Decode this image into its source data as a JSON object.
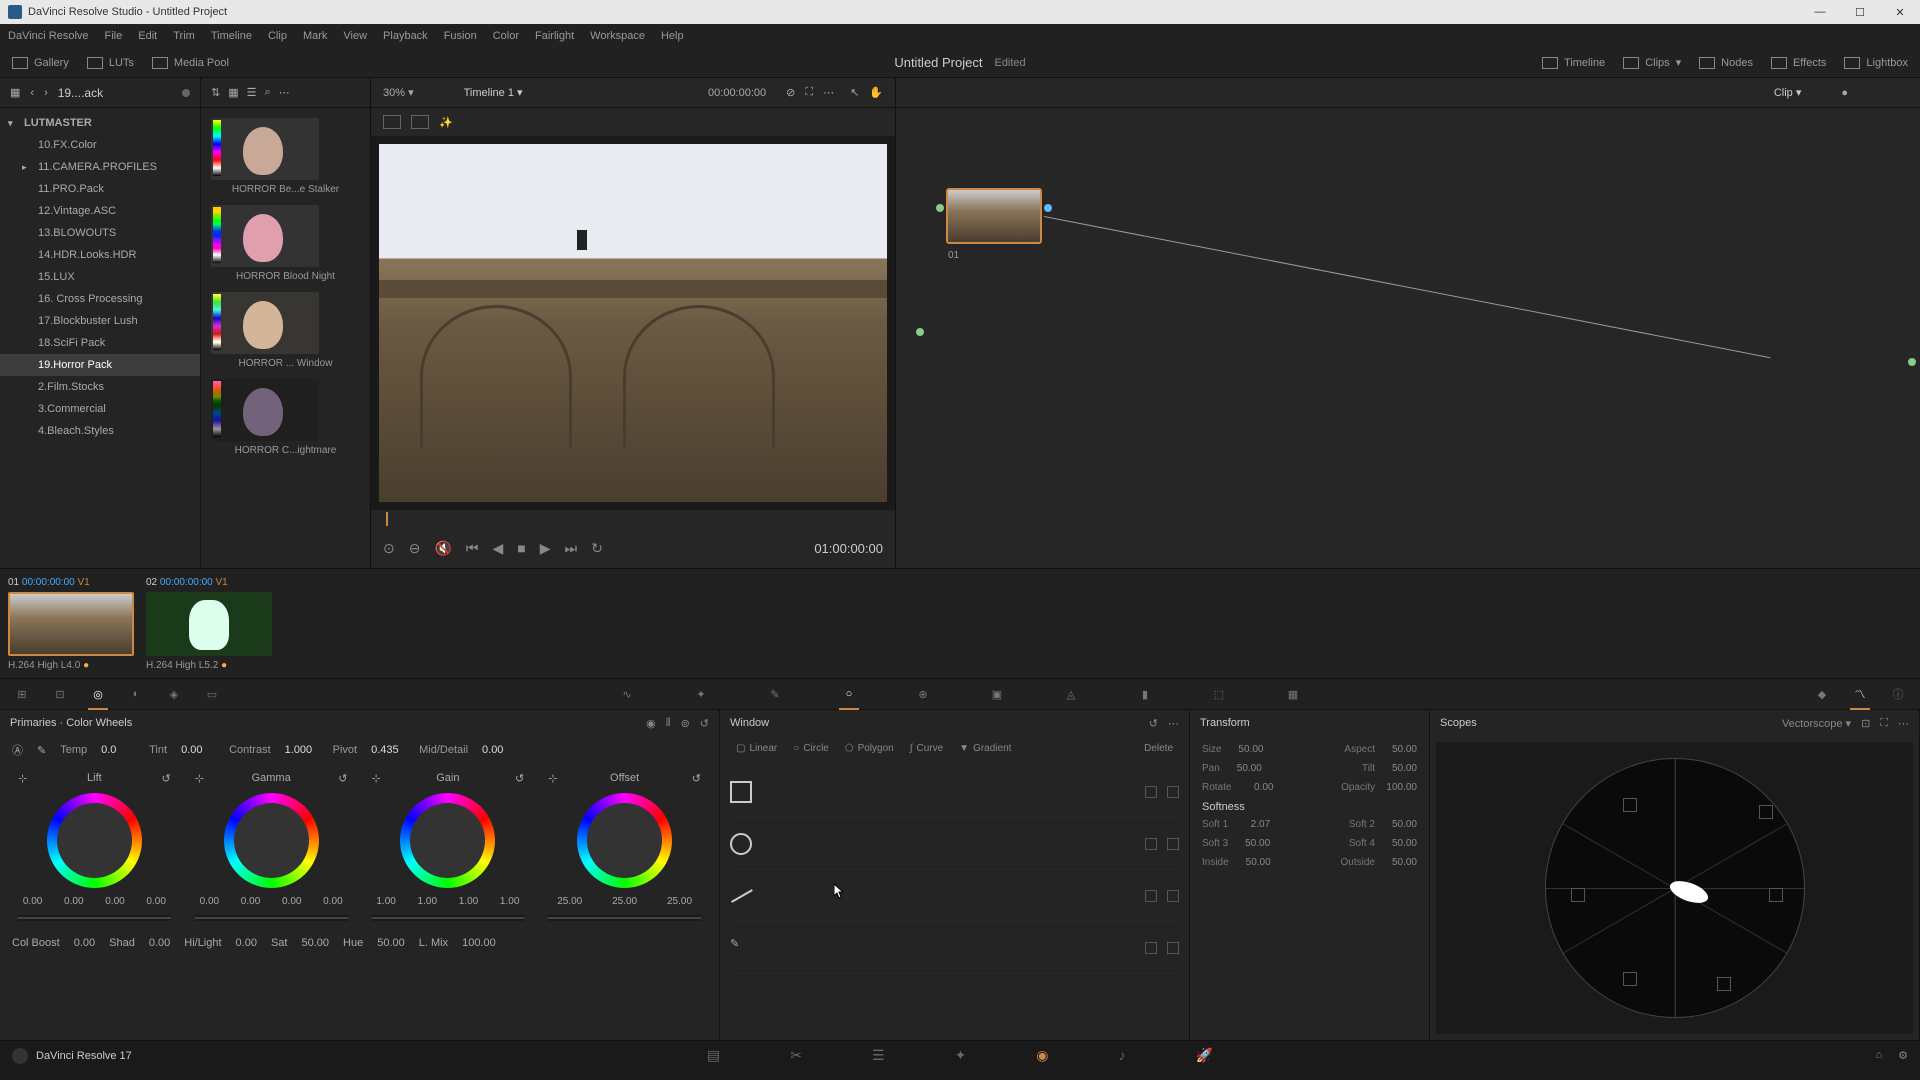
{
  "titlebar": {
    "text": "DaVinci Resolve Studio - Untitled Project"
  },
  "menubar": [
    "DaVinci Resolve",
    "File",
    "Edit",
    "Trim",
    "Timeline",
    "Clip",
    "Mark",
    "View",
    "Playback",
    "Fusion",
    "Color",
    "Fairlight",
    "Workspace",
    "Help"
  ],
  "toolbar": {
    "gallery": "Gallery",
    "luts": "LUTs",
    "mediapool": "Media Pool",
    "timeline": "Timeline",
    "clips": "Clips",
    "nodes": "Nodes",
    "effects": "Effects",
    "lightbox": "Lightbox",
    "project": "Untitled Project",
    "edited": "Edited"
  },
  "sidebar": {
    "title": "19....ack",
    "root": "LUTMASTER",
    "items": [
      "10.FX.Color",
      "11.CAMERA.PROFILES",
      "11.PRO.Pack",
      "12.Vintage.ASC",
      "13.BLOWOUTS",
      "14.HDR.Looks.HDR",
      "15.LUX",
      "16. Cross Processing",
      "17.Blockbuster Lush",
      "18.SciFi Pack",
      "19.Horror Pack",
      "2.Film.Stocks",
      "3.Commercial",
      "4.Bleach.Styles"
    ],
    "selected": 10
  },
  "thumbs": [
    {
      "label": "HORROR Be...e Stalker"
    },
    {
      "label": "HORROR Blood Night"
    },
    {
      "label": "HORROR ... Window"
    },
    {
      "label": "HORROR C...ightmare"
    }
  ],
  "viewer": {
    "zoom": "30%",
    "timeline": "Timeline 1",
    "headerTC": "00:00:00:00",
    "playTC": "01:00:00:00"
  },
  "nodes": {
    "clip": "Clip",
    "nodelabel": "01"
  },
  "clips": [
    {
      "num": "01",
      "tc": "00:00:00:00",
      "trk": "V1",
      "info": "H.264 High L4.0",
      "sel": true
    },
    {
      "num": "02",
      "tc": "00:00:00:00",
      "trk": "V1",
      "info": "H.264 High L5.2",
      "sel": false
    }
  ],
  "primaries": {
    "title": "Primaries · Color Wheels",
    "adjust": [
      [
        "Temp",
        "0.0"
      ],
      [
        "Tint",
        "0.00"
      ],
      [
        "Contrast",
        "1.000"
      ],
      [
        "Pivot",
        "0.435"
      ],
      [
        "Mid/Detail",
        "0.00"
      ]
    ],
    "wheels": [
      {
        "name": "Lift",
        "vals": [
          "0.00",
          "0.00",
          "0.00",
          "0.00"
        ]
      },
      {
        "name": "Gamma",
        "vals": [
          "0.00",
          "0.00",
          "0.00",
          "0.00"
        ]
      },
      {
        "name": "Gain",
        "vals": [
          "1.00",
          "1.00",
          "1.00",
          "1.00"
        ]
      },
      {
        "name": "Offset",
        "vals": [
          "25.00",
          "25.00",
          "25.00"
        ]
      }
    ],
    "bottom": [
      [
        "Col Boost",
        "0.00"
      ],
      [
        "Shad",
        "0.00"
      ],
      [
        "Hi/Light",
        "0.00"
      ],
      [
        "Sat",
        "50.00"
      ],
      [
        "Hue",
        "50.00"
      ],
      [
        "L. Mix",
        "100.00"
      ]
    ]
  },
  "window": {
    "title": "Window",
    "tabs": [
      "Linear",
      "Circle",
      "Polygon",
      "Curve",
      "Gradient",
      "Delete"
    ]
  },
  "transform": {
    "title": "Transform",
    "rows": [
      [
        [
          "Size",
          "50.00"
        ],
        [
          "Aspect",
          "50.00"
        ]
      ],
      [
        [
          "Pan",
          "50.00"
        ],
        [
          "Tilt",
          "50.00"
        ]
      ],
      [
        [
          "Rotate",
          "0.00"
        ],
        [
          "Opacity",
          "100.00"
        ]
      ]
    ],
    "softness": "Softness",
    "soft": [
      [
        [
          "Soft 1",
          "2.07"
        ],
        [
          "Soft 2",
          "50.00"
        ]
      ],
      [
        [
          "Soft 3",
          "50.00"
        ],
        [
          "Soft 4",
          "50.00"
        ]
      ],
      [
        [
          "Inside",
          "50.00"
        ],
        [
          "Outside",
          "50.00"
        ]
      ]
    ]
  },
  "scopes": {
    "title": "Scopes",
    "type": "Vectorscope"
  },
  "bottombar": {
    "version": "DaVinci Resolve 17"
  }
}
